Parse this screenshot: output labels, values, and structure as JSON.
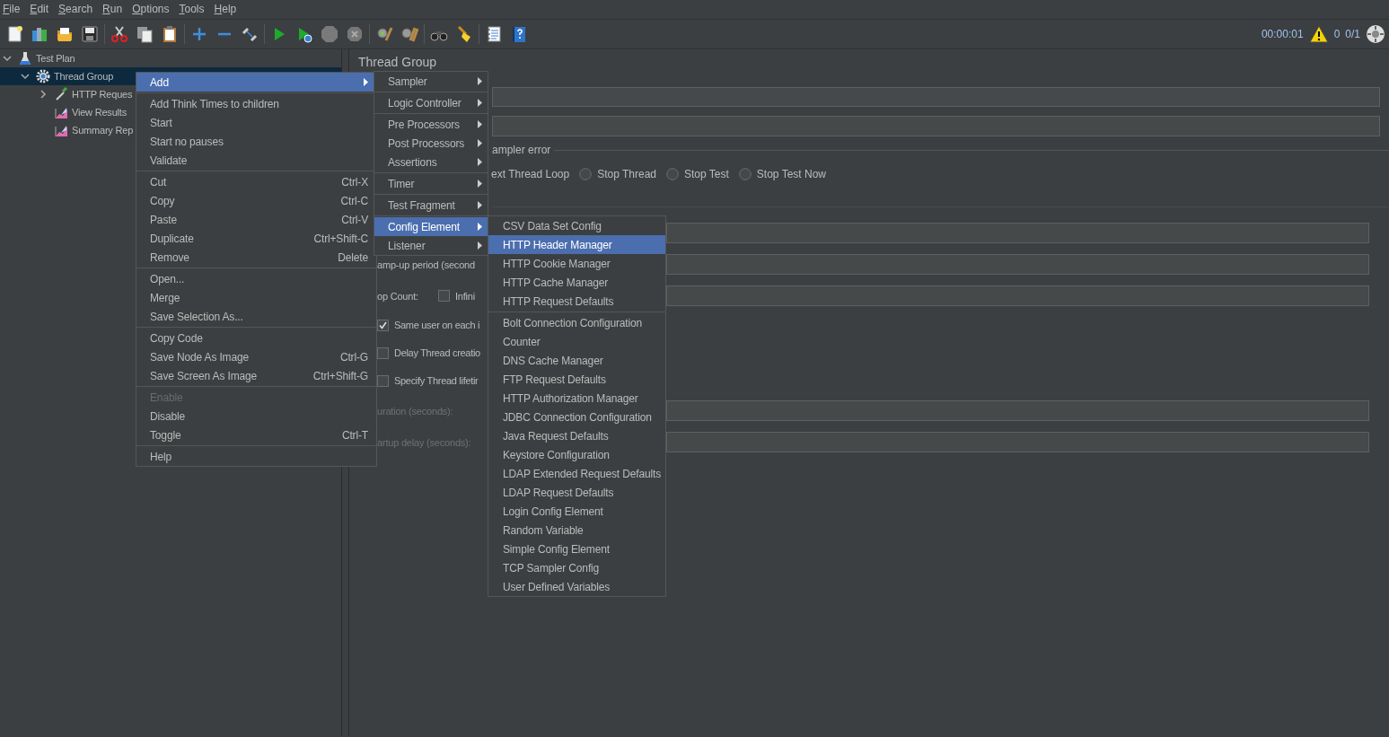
{
  "menu_bar": [
    {
      "label": "File"
    },
    {
      "label": "Edit"
    },
    {
      "label": "Search"
    },
    {
      "label": "Run"
    },
    {
      "label": "Options"
    },
    {
      "label": "Tools"
    },
    {
      "label": "Help"
    }
  ],
  "status": {
    "elapsed": "00:00:01",
    "warnings": "0",
    "threads": "0/1"
  },
  "tree": [
    {
      "label": "Test Plan",
      "kind": "plan",
      "expanded": true,
      "selected": false,
      "children": [
        {
          "label": "Thread Group",
          "kind": "thread_group",
          "expanded": true,
          "selected": true,
          "children": [
            {
              "label": "HTTP Reques",
              "kind": "sampler",
              "expanded": false,
              "selected": false
            },
            {
              "label": "View Results",
              "kind": "listener",
              "selected": false
            },
            {
              "label": "Summary Rep",
              "kind": "listener",
              "selected": false
            }
          ]
        }
      ]
    }
  ],
  "panel": {
    "title": "Thread Group",
    "name_fields": [
      {
        "kind": "field"
      },
      {
        "kind": "field"
      }
    ],
    "error_group": {
      "legend": "ampler error",
      "partial_option": "ext Thread Loop",
      "options": [
        {
          "label": "Stop Thread",
          "selected": false
        },
        {
          "label": "Stop Test",
          "selected": false
        },
        {
          "label": "Stop Test Now",
          "selected": false
        }
      ]
    },
    "rows": [
      {
        "kind": "field"
      },
      {
        "kind": "field",
        "label": "amp-up period (second",
        "disabled": false
      },
      {
        "kind": "field",
        "label": "op Count:",
        "disabled": false,
        "checkbox": {
          "label": "Infini",
          "checked": false
        }
      },
      {
        "kind": "checkbox",
        "label": "Same user on each i",
        "checked": true
      },
      {
        "kind": "checkbox",
        "label": "Delay Thread creatio",
        "checked": false
      },
      {
        "kind": "checkbox",
        "label": "Specify Thread lifetir",
        "checked": false
      },
      {
        "kind": "field",
        "label": "uration (seconds):",
        "disabled": true
      },
      {
        "kind": "field",
        "label": "artup delay (seconds):",
        "disabled": true
      }
    ]
  },
  "context_menu": {
    "groups": [
      [
        {
          "label": "Add",
          "selected": true,
          "disabled": false,
          "has_submenu": true
        }
      ],
      [
        {
          "label": "Add Think Times to children",
          "selected": false,
          "disabled": false,
          "has_submenu": false
        },
        {
          "label": "Start",
          "selected": false,
          "disabled": false,
          "has_submenu": false
        },
        {
          "label": "Start no pauses",
          "selected": false,
          "disabled": false,
          "has_submenu": false
        },
        {
          "label": "Validate",
          "selected": false,
          "disabled": false,
          "has_submenu": false
        }
      ],
      [
        {
          "label": "Cut",
          "shortcut": "Ctrl-X",
          "selected": false,
          "disabled": false,
          "has_submenu": false
        },
        {
          "label": "Copy",
          "shortcut": "Ctrl-C",
          "selected": false,
          "disabled": false,
          "has_submenu": false
        },
        {
          "label": "Paste",
          "shortcut": "Ctrl-V",
          "selected": false,
          "disabled": false,
          "has_submenu": false
        },
        {
          "label": "Duplicate",
          "shortcut": "Ctrl+Shift-C",
          "selected": false,
          "disabled": false,
          "has_submenu": false
        },
        {
          "label": "Remove",
          "shortcut": "Delete",
          "selected": false,
          "disabled": false,
          "has_submenu": false
        }
      ],
      [
        {
          "label": "Open...",
          "selected": false,
          "disabled": false,
          "has_submenu": false
        },
        {
          "label": "Merge",
          "selected": false,
          "disabled": false,
          "has_submenu": false
        },
        {
          "label": "Save Selection As...",
          "selected": false,
          "disabled": false,
          "has_submenu": false
        }
      ],
      [
        {
          "label": "Copy Code",
          "selected": false,
          "disabled": false,
          "has_submenu": false
        },
        {
          "label": "Save Node As Image",
          "shortcut": "Ctrl-G",
          "selected": false,
          "disabled": false,
          "has_submenu": false
        },
        {
          "label": "Save Screen As Image",
          "shortcut": "Ctrl+Shift-G",
          "selected": false,
          "disabled": false,
          "has_submenu": false
        }
      ],
      [
        {
          "label": "Enable",
          "selected": false,
          "disabled": true,
          "has_submenu": false
        },
        {
          "label": "Disable",
          "selected": false,
          "disabled": false,
          "has_submenu": false
        },
        {
          "label": "Toggle",
          "shortcut": "Ctrl-T",
          "selected": false,
          "disabled": false,
          "has_submenu": false
        }
      ],
      [
        {
          "label": "Help",
          "selected": false,
          "disabled": false,
          "has_submenu": false
        }
      ]
    ]
  },
  "add_submenu": {
    "groups": [
      [
        {
          "label": "Sampler",
          "selected": false,
          "has_submenu": true
        }
      ],
      [
        {
          "label": "Logic Controller",
          "selected": false,
          "has_submenu": true
        }
      ],
      [
        {
          "label": "Pre Processors",
          "selected": false,
          "has_submenu": true
        },
        {
          "label": "Post Processors",
          "selected": false,
          "has_submenu": true
        },
        {
          "label": "Assertions",
          "selected": false,
          "has_submenu": true
        }
      ],
      [
        {
          "label": "Timer",
          "selected": false,
          "has_submenu": true
        }
      ],
      [
        {
          "label": "Test Fragment",
          "selected": false,
          "has_submenu": true
        }
      ],
      [
        {
          "label": "Config Element",
          "selected": true,
          "has_submenu": true
        },
        {
          "label": "Listener",
          "selected": false,
          "has_submenu": true
        }
      ]
    ]
  },
  "config_submenu": {
    "groups": [
      [
        {
          "label": "CSV Data Set Config",
          "selected": false
        },
        {
          "label": "HTTP Header Manager",
          "selected": true
        },
        {
          "label": "HTTP Cookie Manager",
          "selected": false
        },
        {
          "label": "HTTP Cache Manager",
          "selected": false
        },
        {
          "label": "HTTP Request Defaults",
          "selected": false
        }
      ],
      [
        {
          "label": "Bolt Connection Configuration",
          "selected": false
        },
        {
          "label": "Counter",
          "selected": false
        },
        {
          "label": "DNS Cache Manager",
          "selected": false
        },
        {
          "label": "FTP Request Defaults",
          "selected": false
        },
        {
          "label": "HTTP Authorization Manager",
          "selected": false
        },
        {
          "label": "JDBC Connection Configuration",
          "selected": false
        },
        {
          "label": "Java Request Defaults",
          "selected": false
        },
        {
          "label": "Keystore Configuration",
          "selected": false
        },
        {
          "label": "LDAP Extended Request Defaults",
          "selected": false
        },
        {
          "label": "LDAP Request Defaults",
          "selected": false
        },
        {
          "label": "Login Config Element",
          "selected": false
        },
        {
          "label": "Random Variable",
          "selected": false
        },
        {
          "label": "Simple Config Element",
          "selected": false
        },
        {
          "label": "TCP Sampler Config",
          "selected": false
        },
        {
          "label": "User Defined Variables",
          "selected": false
        }
      ]
    ]
  }
}
